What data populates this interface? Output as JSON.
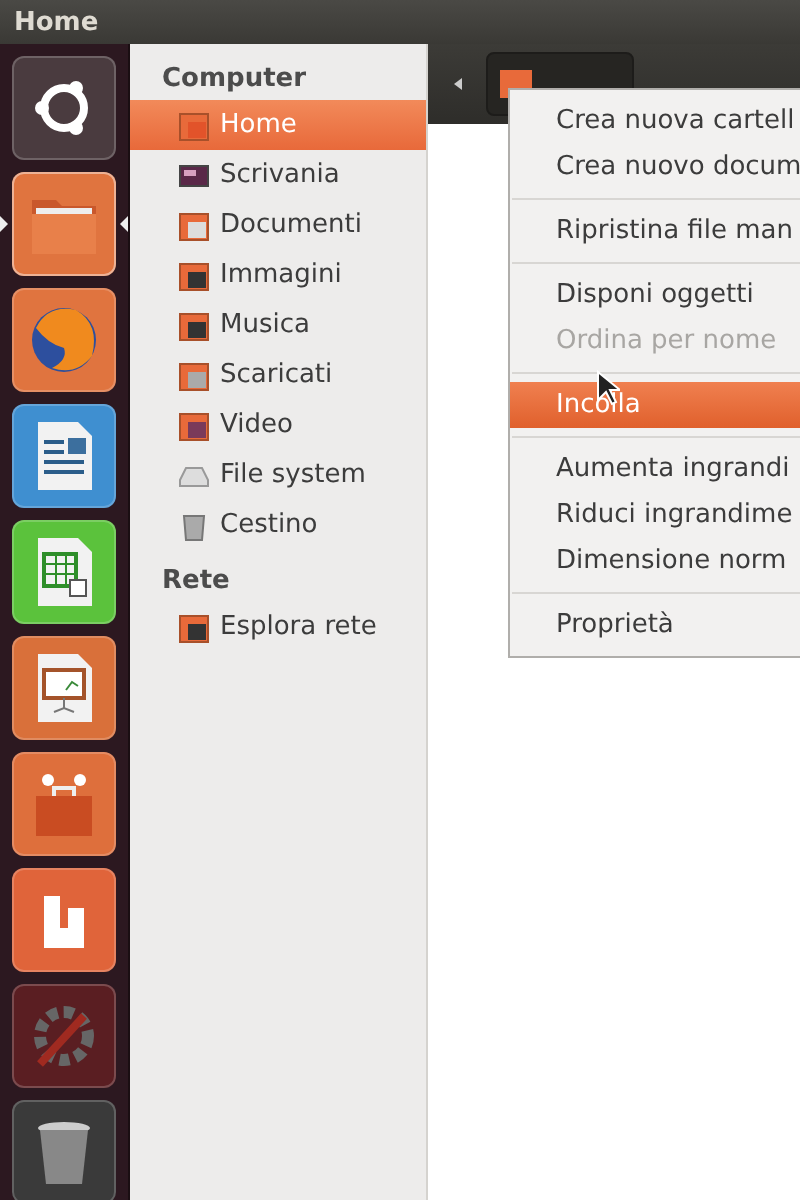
{
  "window": {
    "title": "Home"
  },
  "launcher": [
    {
      "kind": "dash",
      "active": false
    },
    {
      "kind": "files",
      "active": true
    },
    {
      "kind": "browser",
      "active": false
    },
    {
      "kind": "writer",
      "active": false
    },
    {
      "kind": "calc",
      "active": false
    },
    {
      "kind": "impress",
      "active": false
    },
    {
      "kind": "store",
      "active": false
    },
    {
      "kind": "cloud",
      "active": false
    },
    {
      "kind": "settings",
      "active": false
    },
    {
      "kind": "trash",
      "active": false
    }
  ],
  "sidebar": [
    {
      "heading": "Computer",
      "items": [
        {
          "label": "Home",
          "kind": "home",
          "selected": true
        },
        {
          "label": "Scrivania",
          "kind": "desktop",
          "selected": false
        },
        {
          "label": "Documenti",
          "kind": "documents",
          "selected": false
        },
        {
          "label": "Immagini",
          "kind": "pictures",
          "selected": false
        },
        {
          "label": "Musica",
          "kind": "music",
          "selected": false
        },
        {
          "label": "Scaricati",
          "kind": "downloads",
          "selected": false
        },
        {
          "label": "Video",
          "kind": "video",
          "selected": false
        },
        {
          "label": "File system",
          "kind": "drive",
          "selected": false
        },
        {
          "label": "Cestino",
          "kind": "trash",
          "selected": false
        }
      ]
    },
    {
      "heading": "Rete",
      "items": [
        {
          "label": "Esplora rete",
          "kind": "network",
          "selected": false
        }
      ]
    }
  ],
  "context_menu": [
    [
      {
        "label": "Crea nuova cartell",
        "disabled": false,
        "selected": false
      },
      {
        "label": "Crea nuovo docum",
        "disabled": false,
        "selected": false
      }
    ],
    [
      {
        "label": "Ripristina file man",
        "disabled": false,
        "selected": false
      }
    ],
    [
      {
        "label": "Disponi oggetti",
        "disabled": false,
        "selected": false
      },
      {
        "label": "Ordina per nome",
        "disabled": true,
        "selected": false
      }
    ],
    [
      {
        "label": "Incolla",
        "disabled": false,
        "selected": true
      }
    ],
    [
      {
        "label": "Aumenta ingrandi",
        "disabled": false,
        "selected": false
      },
      {
        "label": "Riduci ingrandime",
        "disabled": false,
        "selected": false
      },
      {
        "label": "Dimensione norm",
        "disabled": false,
        "selected": false
      }
    ],
    [
      {
        "label": "Proprietà",
        "disabled": false,
        "selected": false
      }
    ]
  ]
}
